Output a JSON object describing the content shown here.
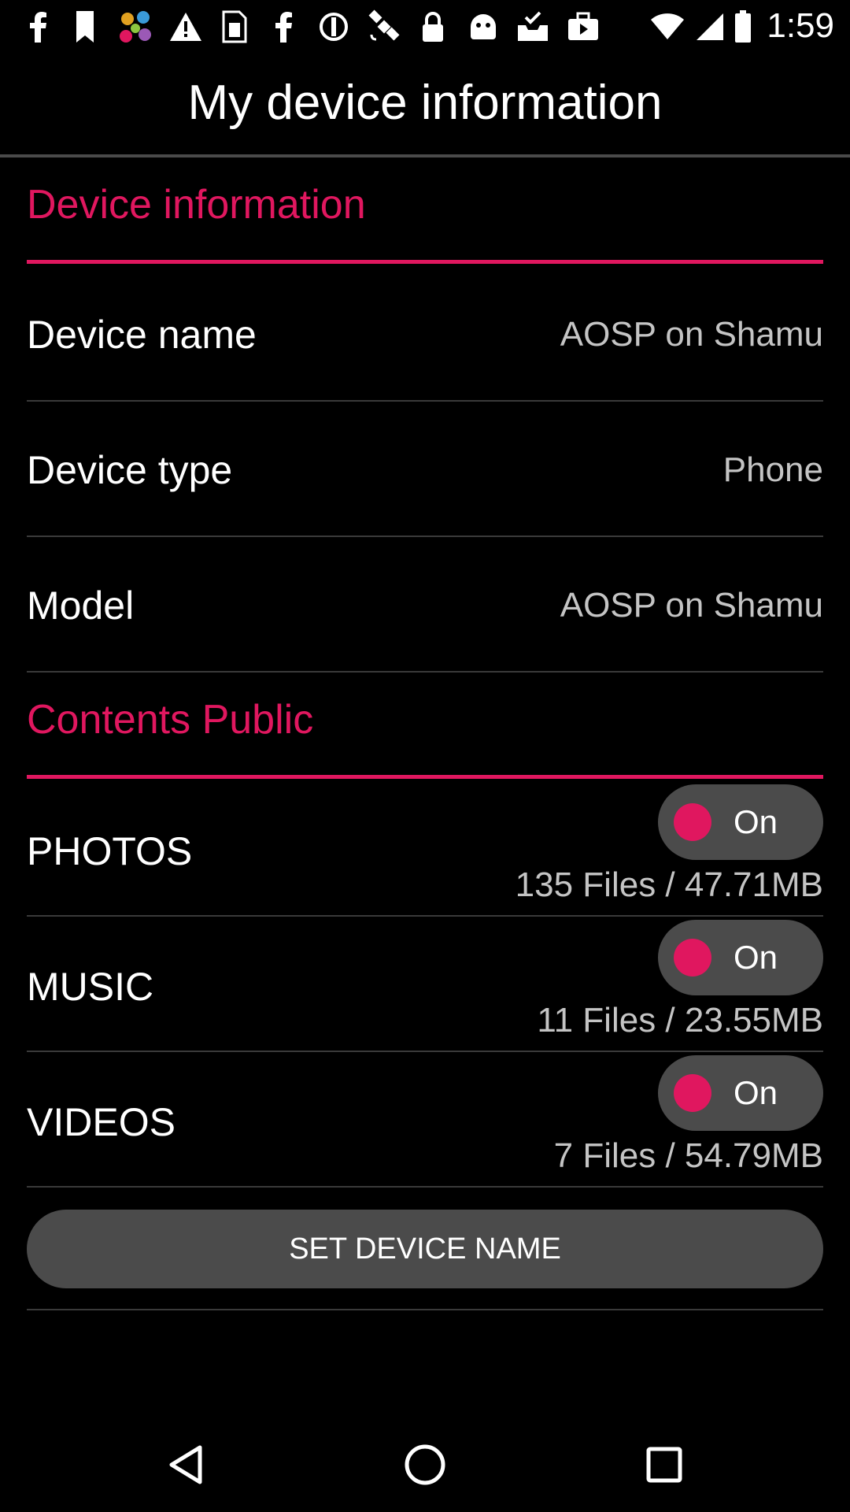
{
  "status_bar": {
    "time": "1:59",
    "icons": [
      "facebook-icon",
      "tag-icon",
      "app-dots-icon",
      "warning-icon",
      "sim-icon",
      "facebook-icon",
      "block-icon",
      "satellite-icon",
      "lock-icon",
      "android-icon",
      "inbox-check-icon",
      "briefcase-play-icon"
    ]
  },
  "header": {
    "title": "My device information"
  },
  "device_section": {
    "title": "Device information",
    "rows": [
      {
        "label": "Device name",
        "value": "AOSP on Shamu"
      },
      {
        "label": "Device type",
        "value": "Phone"
      },
      {
        "label": "Model",
        "value": "AOSP on Shamu"
      }
    ]
  },
  "contents_section": {
    "title": "Contents Public",
    "items": [
      {
        "label": "PHOTOS",
        "toggle": "On",
        "stats": "135 Files / 47.71MB"
      },
      {
        "label": "MUSIC",
        "toggle": "On",
        "stats": "11 Files / 23.55MB"
      },
      {
        "label": "VIDEOS",
        "toggle": "On",
        "stats": "7 Files / 54.79MB"
      }
    ]
  },
  "actions": {
    "set_device_name": "SET DEVICE NAME"
  },
  "nav": {
    "icons": [
      "back-icon",
      "home-icon",
      "recents-icon"
    ]
  },
  "colors": {
    "accent": "#e0175f",
    "background": "#000000",
    "toggle_bg": "#4b4b4b"
  }
}
